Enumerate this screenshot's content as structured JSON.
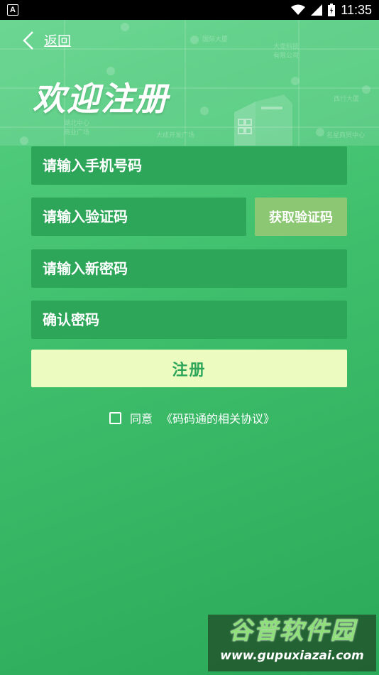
{
  "status_bar": {
    "app_icon_letter": "A",
    "time": "11:35"
  },
  "header": {
    "back_label": "返回",
    "title": "欢迎注册"
  },
  "form": {
    "phone_placeholder": "请输入手机号码",
    "code_placeholder": "请输入验证码",
    "get_code_label": "获取验证码",
    "new_password_placeholder": "请输入新密码",
    "confirm_password_placeholder": "确认密码",
    "register_label": "注册",
    "agree_label": "同意",
    "agreement_link": "《码码通的相关协议》",
    "agree_checked": false
  },
  "watermark": {
    "title": "谷普软件园",
    "url": "www.gupuxiazai.com"
  },
  "colors": {
    "background": "#3fbf6c",
    "field": "#2ea65a",
    "get_code_button": "#8cc873",
    "register_button": "#ecfcc0"
  }
}
